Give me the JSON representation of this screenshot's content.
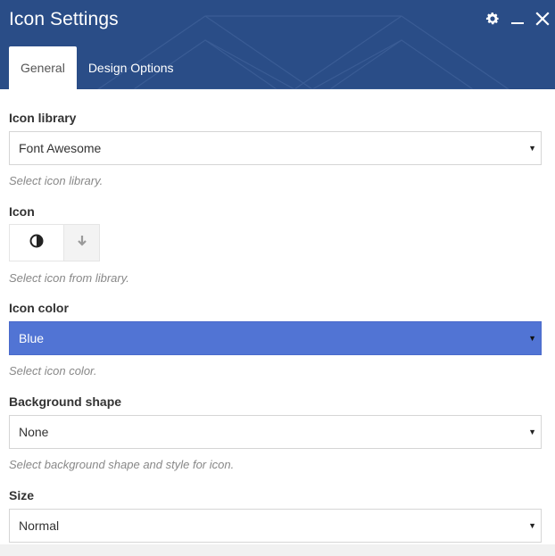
{
  "window": {
    "title": "Icon Settings",
    "icons": [
      "gear-icon",
      "minimize-icon",
      "close-icon"
    ]
  },
  "tabs": [
    {
      "label": "General",
      "active": true
    },
    {
      "label": "Design Options",
      "active": false
    }
  ],
  "fields": {
    "icon_library": {
      "label": "Icon library",
      "value": "Font Awesome",
      "help": "Select icon library."
    },
    "icon": {
      "label": "Icon",
      "selected_icon": "adjust-icon",
      "help": "Select icon from library."
    },
    "icon_color": {
      "label": "Icon color",
      "value": "Blue",
      "help": "Select icon color.",
      "swatch": "#5174d4"
    },
    "background_shape": {
      "label": "Background shape",
      "value": "None",
      "help": "Select background shape and style for icon."
    },
    "size": {
      "label": "Size",
      "value": "Normal"
    }
  },
  "colors": {
    "header": "#2a4d87",
    "accent_blue": "#5174d4"
  }
}
